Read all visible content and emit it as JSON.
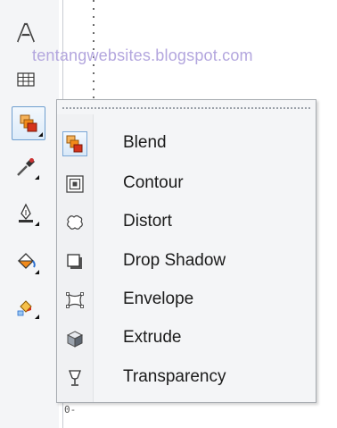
{
  "watermark": "tentangwebsites.blogspot.com",
  "ruler": {
    "tail": "0-"
  },
  "toolbox": {
    "tools": [
      {
        "name": "text-tool-icon"
      },
      {
        "name": "table-tool-icon"
      },
      {
        "name": "interactive-effects-tool-icon",
        "active": true
      },
      {
        "name": "eyedropper-tool-icon"
      },
      {
        "name": "outline-pen-tool-icon"
      },
      {
        "name": "fill-tool-icon"
      },
      {
        "name": "interactive-fill-tool-icon"
      }
    ]
  },
  "flyout": {
    "items": [
      {
        "label": "Blend",
        "icon": "blend-icon",
        "active": true
      },
      {
        "label": "Contour",
        "icon": "contour-icon"
      },
      {
        "label": "Distort",
        "icon": "distort-icon"
      },
      {
        "label": "Drop Shadow",
        "icon": "drop-shadow-icon"
      },
      {
        "label": "Envelope",
        "icon": "envelope-icon"
      },
      {
        "label": "Extrude",
        "icon": "extrude-icon"
      },
      {
        "label": "Transparency",
        "icon": "transparency-icon"
      }
    ]
  },
  "colors": {
    "accent_orange": "#f08a1d",
    "accent_red": "#d9321c",
    "highlight_border": "#6e9ecf"
  }
}
